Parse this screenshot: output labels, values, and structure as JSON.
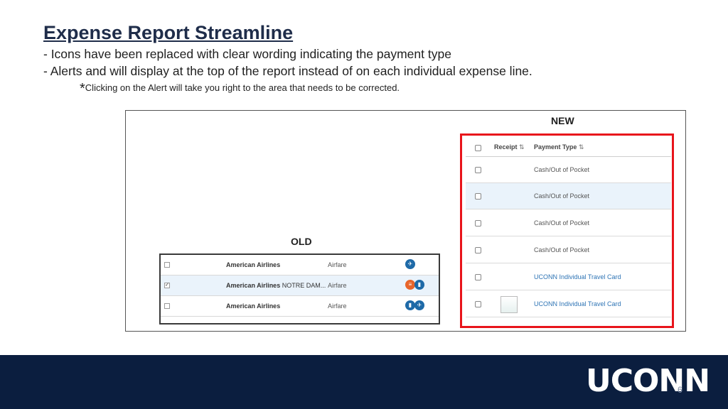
{
  "slide": {
    "title": "Expense Report Streamline",
    "bullets": [
      "- Icons have been replaced with clear wording indicating the payment type",
      "- Alerts and will display at the top of the report instead of on each individual expense line."
    ],
    "note_star": "*",
    "note": "Clicking on the Alert will take you right to the area that needs to be corrected.",
    "page_number": "6",
    "logo_text": "UCONN"
  },
  "old_panel": {
    "label": "OLD",
    "rows": [
      {
        "vendor": "American Airlines",
        "extra": "",
        "type": "Airfare",
        "checked": false,
        "icons": [
          "airplane-icon"
        ]
      },
      {
        "vendor": "American Airlines",
        "extra": " NOTRE DAM...",
        "type": "Airfare",
        "checked": true,
        "icons": [
          "receipt-alert-icon",
          "card-icon"
        ]
      },
      {
        "vendor": "American Airlines",
        "extra": "",
        "type": "Airfare",
        "checked": false,
        "icons": [
          "card-icon",
          "airplane-icon"
        ]
      }
    ]
  },
  "new_panel": {
    "label": "NEW",
    "header": {
      "receipt": "Receipt",
      "payment_type": "Payment Type",
      "sort_glyph": "⇅"
    },
    "rows": [
      {
        "payment_type": "Cash/Out of Pocket",
        "has_receipt": false
      },
      {
        "payment_type": "Cash/Out of Pocket",
        "has_receipt": false
      },
      {
        "payment_type": "Cash/Out of Pocket",
        "has_receipt": false
      },
      {
        "payment_type": "Cash/Out of Pocket",
        "has_receipt": false
      },
      {
        "payment_type": "UCONN Individual Travel Card",
        "has_receipt": false
      },
      {
        "payment_type": "UCONN Individual Travel Card",
        "has_receipt": true
      }
    ]
  },
  "colors": {
    "title": "#1f2d4a",
    "highlight_border": "#e8141b",
    "footer": "#0b1e3f",
    "link": "#2e74b5",
    "icon_blue": "#1e6aa8",
    "icon_orange": "#e8652b"
  }
}
